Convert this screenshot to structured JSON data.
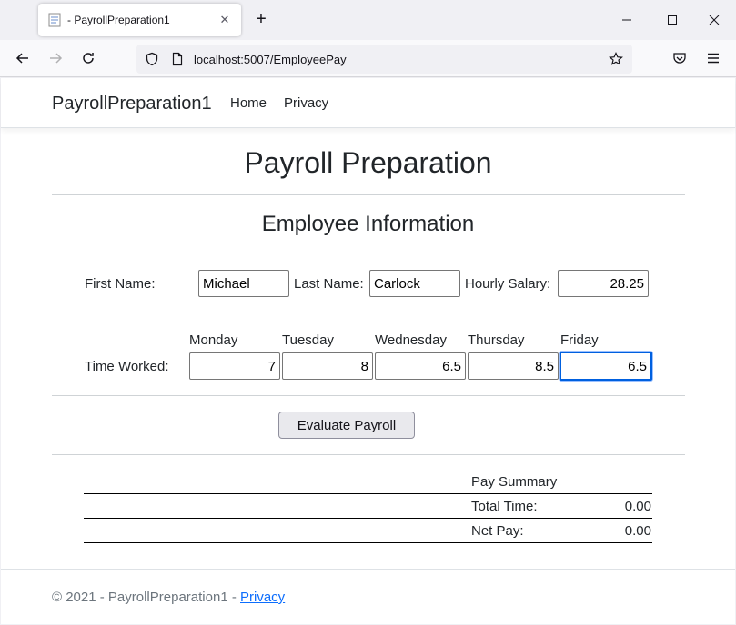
{
  "browser": {
    "tab_title": "- PayrollPreparation1",
    "url": "localhost:5007/EmployeePay"
  },
  "site": {
    "brand": "PayrollPreparation1",
    "nav": [
      "Home",
      "Privacy"
    ]
  },
  "page": {
    "title": "Payroll Preparation",
    "section_title": "Employee Information",
    "employee": {
      "first_name_label": "First Name:",
      "first_name": "Michael",
      "last_name_label": "Last Name:",
      "last_name": "Carlock",
      "hourly_salary_label": "Hourly Salary:",
      "hourly_salary": "28.25"
    },
    "time_worked": {
      "label": "Time Worked:",
      "days": [
        {
          "name": "Monday",
          "value": "7"
        },
        {
          "name": "Tuesday",
          "value": "8"
        },
        {
          "name": "Wednesday",
          "value": "6.5"
        },
        {
          "name": "Thursday",
          "value": "8.5"
        },
        {
          "name": "Friday",
          "value": "6.5"
        }
      ]
    },
    "evaluate_button": "Evaluate Payroll",
    "summary": {
      "title": "Pay Summary",
      "total_time_label": "Total Time:",
      "total_time": "0.00",
      "net_pay_label": "Net Pay:",
      "net_pay": "0.00"
    }
  },
  "footer": {
    "text": "© 2021 - PayrollPreparation1 - ",
    "link": "Privacy"
  }
}
